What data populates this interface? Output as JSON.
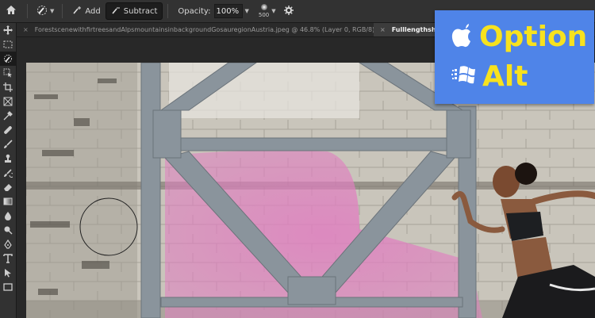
{
  "options_bar": {
    "add_label": "Add",
    "subtract_label": "Subtract",
    "opacity_label": "Opacity:",
    "opacity_value": "100%",
    "brush_size": "500"
  },
  "tabs": [
    {
      "label": "ForestscenewithfirtreesandAlpsmountainsinbackgroundGosauregionAustria.jpeg @ 46.8% (Layer 0, RGB/8) *",
      "active": false
    },
    {
      "label": "Fulllengthshotofy",
      "active": true
    }
  ],
  "overlay": {
    "mac_key": "Option",
    "win_key": "Alt",
    "bg_color": "#4f84e8",
    "text_color": "#f7e21e"
  },
  "icons": [
    "home-icon",
    "eraser-brush-icon",
    "add-icon",
    "subtract-icon",
    "brush-tip-icon",
    "gear-icon",
    "apple-icon",
    "windows-icon"
  ],
  "colors": {
    "panel": "#323232",
    "canvas": "#282828",
    "mask_pink": "#e07fc0",
    "steel": "#8a949c"
  }
}
